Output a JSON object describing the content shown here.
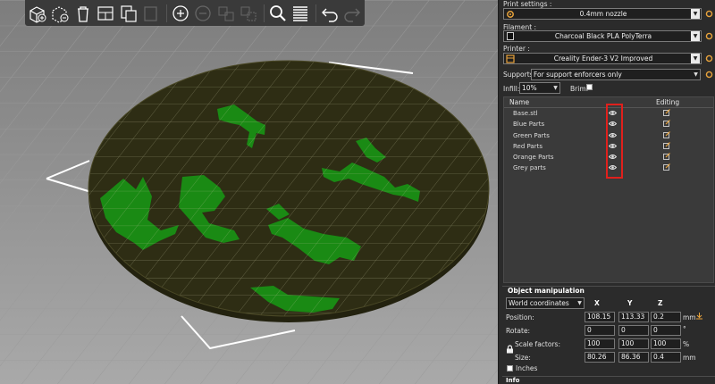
{
  "toolbar": {
    "buttons": [
      {
        "name": "add-icon"
      },
      {
        "name": "delete-icon"
      },
      {
        "name": "delete-all-icon"
      },
      {
        "name": "arrange-icon"
      },
      {
        "name": "copy-icon"
      },
      {
        "name": "paste-icon"
      },
      {
        "name": "add-instance-icon"
      },
      {
        "name": "remove-instance-icon"
      },
      {
        "name": "split-objects-icon"
      },
      {
        "name": "split-parts-icon"
      },
      {
        "name": "search-icon"
      },
      {
        "name": "layers-icon"
      },
      {
        "name": "undo-icon"
      },
      {
        "name": "redo-icon"
      }
    ]
  },
  "settings": {
    "print_label": "Print settings :",
    "print_value": "0.4mm nozzle",
    "filament_label": "Filament :",
    "filament_value": "Charcoal Black PLA PolyTerra",
    "filament_color": "#101010",
    "printer_label": "Printer :",
    "printer_value": "Creality Ender-3 V2 Improved",
    "supports_label": "Supports:",
    "supports_value": "For support enforcers only",
    "infill_label": "Infill:",
    "infill_value": "10%",
    "brim_label": "Brim:"
  },
  "object_list": {
    "col_name": "Name",
    "col_editing": "Editing",
    "rows": [
      {
        "name": "Base.stl"
      },
      {
        "name": "Blue Parts"
      },
      {
        "name": "Green Parts"
      },
      {
        "name": "Red Parts"
      },
      {
        "name": "Orange Parts"
      },
      {
        "name": "Grey parts"
      }
    ]
  },
  "manipulation": {
    "title": "Object manipulation",
    "coord_system": "World coordinates",
    "axes": [
      "X",
      "Y",
      "Z"
    ],
    "position_label": "Position:",
    "position": [
      "108.15",
      "113.33",
      "0.2"
    ],
    "position_unit": "mm",
    "rotate_label": "Rotate:",
    "rotate": [
      "0",
      "0",
      "0"
    ],
    "rotate_unit": "°",
    "scale_label": "Scale factors:",
    "scale": [
      "100",
      "100",
      "100"
    ],
    "scale_unit": "%",
    "size_label": "Size:",
    "size": [
      "80.26",
      "86.36",
      "0.4"
    ],
    "size_unit": "mm",
    "inches_label": "Inches"
  },
  "info": {
    "label": "Info"
  },
  "colors": {
    "accent": "#e8a33c",
    "highlight": "#e0201c",
    "part_green": "#1a8a14",
    "base_olive": "#2e2d14"
  }
}
